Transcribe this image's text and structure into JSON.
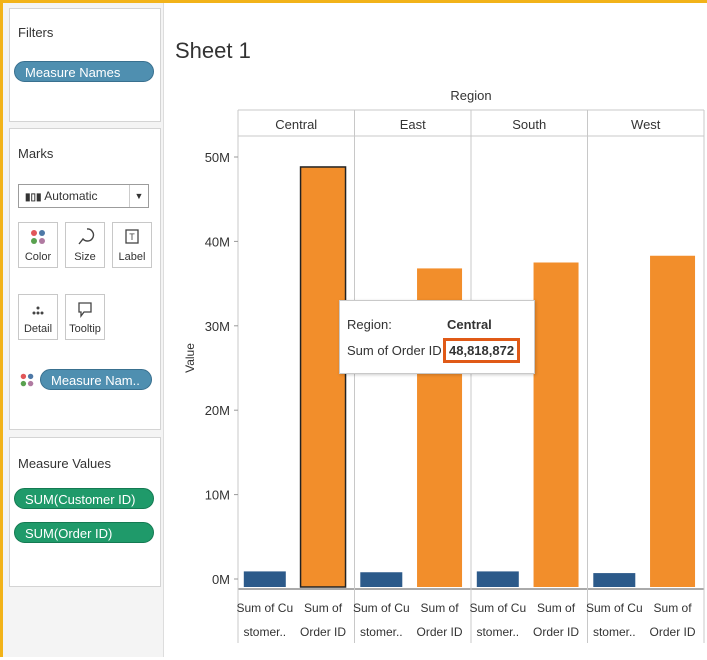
{
  "sheet_title": "Sheet 1",
  "filters": {
    "title": "Filters",
    "pills": [
      "Measure Names"
    ]
  },
  "marks": {
    "title": "Marks",
    "mark_type": "Automatic",
    "buttons": {
      "color": "Color",
      "size": "Size",
      "label": "Label",
      "detail": "Detail",
      "tooltip": "Tooltip"
    },
    "color_pill": "Measure Nam.."
  },
  "measure_values": {
    "title": "Measure Values",
    "pills": [
      "SUM(Customer ID)",
      "SUM(Order ID)"
    ]
  },
  "tooltip": {
    "region_label": "Region:",
    "region_value": "Central",
    "measure_label": "Sum of Order ID",
    "measure_value": "48,818,872"
  },
  "colors": {
    "customer_bar": "#2c5a8a",
    "order_bar": "#f28e2b",
    "frame": "#f2b319",
    "pill_blue": "#4f8fb0",
    "pill_green": "#1f9a6a",
    "highlight": "#e05a17"
  },
  "chart_data": {
    "type": "bar",
    "title": "Sheet 1",
    "column_header": "Region",
    "ylabel": "Value",
    "ylim": [
      0,
      50000000
    ],
    "yticks": [
      "0M",
      "10M",
      "20M",
      "30M",
      "40M",
      "50M"
    ],
    "groups": [
      "Central",
      "East",
      "South",
      "West"
    ],
    "category_labels": [
      [
        "Sum of Cu",
        "stomer.."
      ],
      [
        "Sum of",
        "Order ID"
      ]
    ],
    "series": [
      {
        "name": "Sum of Customer ID",
        "values": [
          900000,
          800000,
          900000,
          700000
        ]
      },
      {
        "name": "Sum of Order ID",
        "values": [
          48818872,
          36800000,
          37500000,
          38300000
        ]
      }
    ],
    "highlighted": {
      "group": "Central",
      "series": "Sum of Order ID"
    },
    "grid": false
  }
}
